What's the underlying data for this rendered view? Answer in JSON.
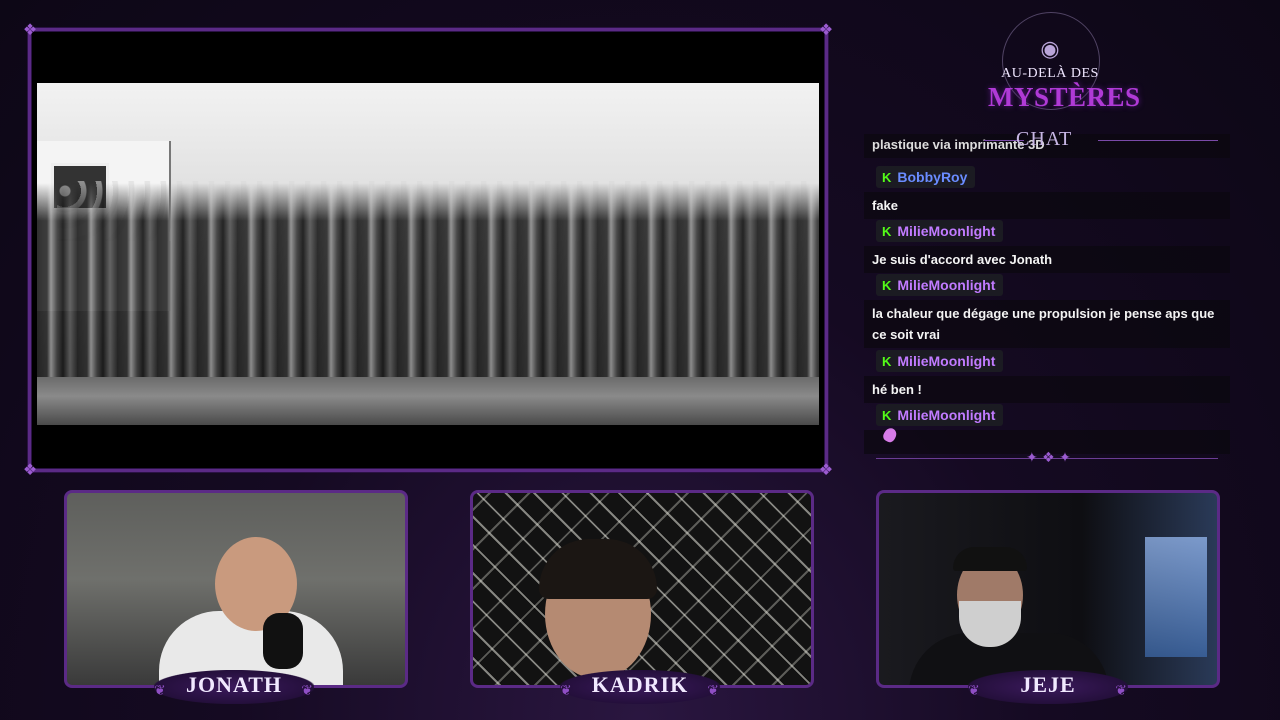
{
  "branding": {
    "logo_top": "AU-DELÀ DES",
    "logo_bottom": "MYSTÈRES",
    "logo_icon": "all-seeing-eye-icon"
  },
  "chat": {
    "title": "CHAT",
    "partial_line": "plastique via imprimante 3D",
    "messages": [
      {
        "user": "BobbyRoy",
        "user_color": "#6a8cff",
        "badge": "K",
        "text": "fake"
      },
      {
        "user": "MilieMoonlight",
        "user_color": "#c17bff",
        "badge": "K",
        "text": "Je suis d'accord avec Jonath"
      },
      {
        "user": "MilieMoonlight",
        "user_color": "#c17bff",
        "badge": "K",
        "text": "la chaleur que dégage une propulsion je pense aps que ce soit vrai"
      },
      {
        "user": "MilieMoonlight",
        "user_color": "#c17bff",
        "badge": "K",
        "text": "hé ben !"
      },
      {
        "user": "MilieMoonlight",
        "user_color": "#c17bff",
        "badge": "K",
        "text": "",
        "emote": "sparkle-emote-icon"
      }
    ],
    "badge_color": "#53fc18"
  },
  "cameras": [
    {
      "name": "JONATH"
    },
    {
      "name": "KADRIK"
    },
    {
      "name": "JEJE"
    }
  ],
  "colors": {
    "frame_border": "#5b2a86",
    "accent_purple": "#b03ad6",
    "background": "#150a22"
  }
}
